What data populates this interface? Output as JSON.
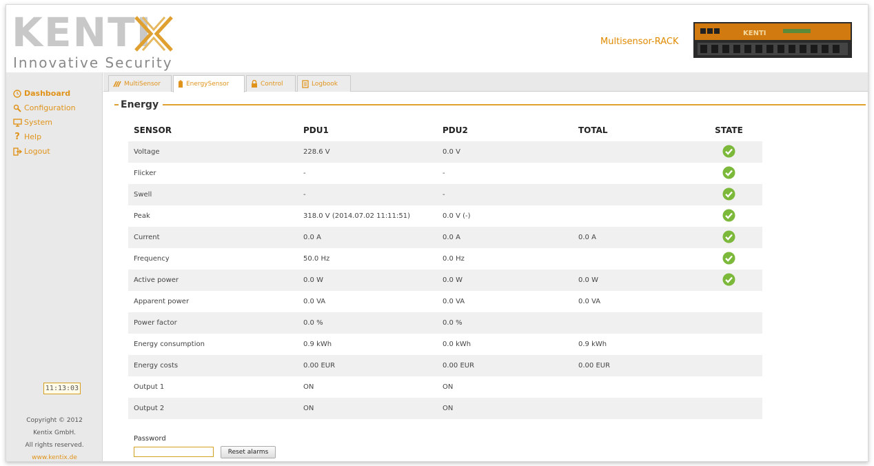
{
  "brand": {
    "name": "KENTI",
    "tagline": "Innovative Security"
  },
  "header": {
    "device_name": "Multisensor-RACK"
  },
  "sidebar": {
    "items": [
      {
        "label": "Dashboard",
        "icon": "dashboard-icon"
      },
      {
        "label": "Configuration",
        "icon": "configuration-icon"
      },
      {
        "label": "System",
        "icon": "monitor-icon"
      },
      {
        "label": "Help",
        "icon": "help-icon"
      },
      {
        "label": "Logout",
        "icon": "logout-icon"
      }
    ],
    "clock": "11:13:03",
    "copyright": [
      "Copyright © 2012",
      "Kentix GmbH.",
      "All rights reserved."
    ],
    "link": "www.kentix.de"
  },
  "tabs": [
    {
      "label": "MultiSensor",
      "icon": "multisensor-icon"
    },
    {
      "label": "EnergySensor",
      "icon": "energy-icon"
    },
    {
      "label": "Control",
      "icon": "lock-icon"
    },
    {
      "label": "Logbook",
      "icon": "logbook-icon"
    }
  ],
  "section": {
    "title": "Energy"
  },
  "table": {
    "headers": [
      "SENSOR",
      "PDU1",
      "PDU2",
      "TOTAL",
      "STATE"
    ],
    "rows": [
      {
        "sensor": "Voltage",
        "pdu1": "228.6 V",
        "pdu2": "0.0 V",
        "total": "",
        "state": true
      },
      {
        "sensor": "Flicker",
        "pdu1": "-",
        "pdu2": "-",
        "total": "",
        "state": true
      },
      {
        "sensor": "Swell",
        "pdu1": "-",
        "pdu2": "-",
        "total": "",
        "state": true
      },
      {
        "sensor": "Peak",
        "pdu1": "318.0 V (2014.07.02 11:11:51)",
        "pdu2": "0.0 V (-)",
        "total": "",
        "state": true
      },
      {
        "sensor": "Current",
        "pdu1": "0.0 A",
        "pdu2": "0.0 A",
        "total": "0.0 A",
        "state": true
      },
      {
        "sensor": "Frequency",
        "pdu1": "50.0 Hz",
        "pdu2": "0.0 Hz",
        "total": "",
        "state": true
      },
      {
        "sensor": "Active power",
        "pdu1": "0.0 W",
        "pdu2": "0.0 W",
        "total": "0.0 W",
        "state": true
      },
      {
        "sensor": "Apparent power",
        "pdu1": "0.0 VA",
        "pdu2": "0.0 VA",
        "total": "0.0 VA",
        "state": false
      },
      {
        "sensor": "Power factor",
        "pdu1": "0.0 %",
        "pdu2": "0.0 %",
        "total": "",
        "state": false
      },
      {
        "sensor": "Energy consumption",
        "pdu1": "0.9 kWh",
        "pdu2": "0.0 kWh",
        "total": "0.9 kWh",
        "state": false
      },
      {
        "sensor": "Energy costs",
        "pdu1": "0.00 EUR",
        "pdu2": "0.00 EUR",
        "total": "0.00 EUR",
        "state": false
      },
      {
        "sensor": "Output 1",
        "pdu1": "ON",
        "pdu2": "ON",
        "total": "",
        "state": false
      },
      {
        "sensor": "Output 2",
        "pdu1": "ON",
        "pdu2": "ON",
        "total": "",
        "state": false
      }
    ]
  },
  "form": {
    "password_label": "Password",
    "password_value": "",
    "reset_label": "Reset alarms"
  },
  "colors": {
    "accent": "#e0931a",
    "ok": "#7cb83a"
  }
}
